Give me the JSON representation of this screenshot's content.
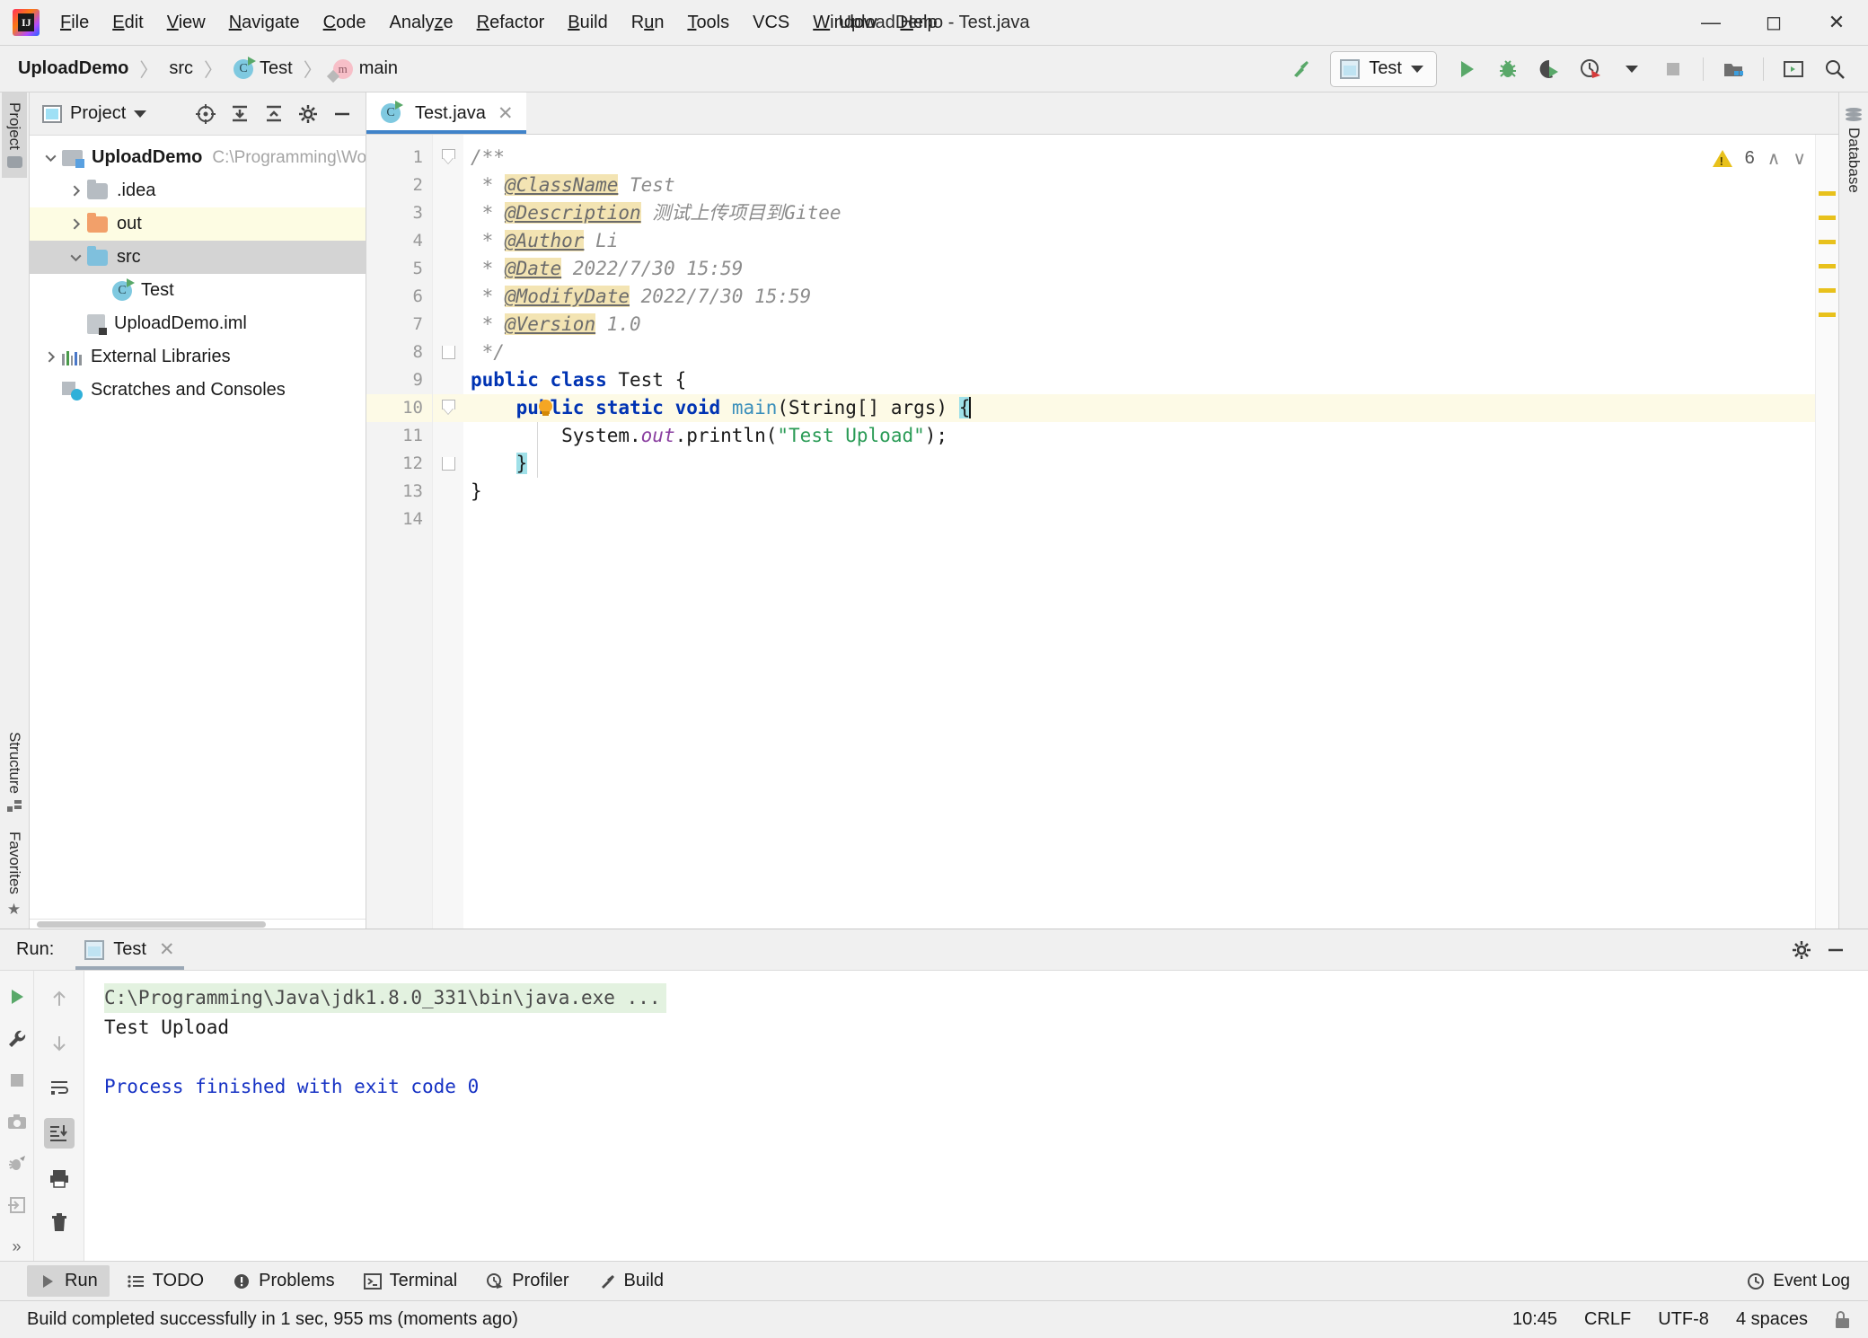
{
  "window": {
    "title": "UploadDemo - Test.java",
    "minimize_label": "─",
    "maximize_label": "☐",
    "close_label": "✕",
    "logo_letter": "IJ"
  },
  "menubar": {
    "items": [
      {
        "label": "File",
        "mnemonic": "F"
      },
      {
        "label": "Edit",
        "mnemonic": "E"
      },
      {
        "label": "View",
        "mnemonic": "V"
      },
      {
        "label": "Navigate",
        "mnemonic": "N"
      },
      {
        "label": "Code",
        "mnemonic": "C"
      },
      {
        "label": "Analyze",
        "mnemonic": "z"
      },
      {
        "label": "Refactor",
        "mnemonic": "R"
      },
      {
        "label": "Build",
        "mnemonic": "B"
      },
      {
        "label": "Run",
        "mnemonic": "u"
      },
      {
        "label": "Tools",
        "mnemonic": "T"
      },
      {
        "label": "VCS",
        "mnemonic": ""
      },
      {
        "label": "Window",
        "mnemonic": "W"
      },
      {
        "label": "Help",
        "mnemonic": "H"
      }
    ]
  },
  "navbar": {
    "breadcrumbs": [
      {
        "label": "UploadDemo",
        "icon": "none",
        "bold": true
      },
      {
        "label": "src",
        "icon": "none",
        "bold": false
      },
      {
        "label": "Test",
        "icon": "class-icon",
        "bold": false
      },
      {
        "label": "main",
        "icon": "method-icon",
        "bold": false
      }
    ],
    "separator": "〉",
    "run_config": {
      "name": "Test",
      "icon": "run-configuration-icon"
    },
    "buttons": [
      {
        "name": "build-hammer-icon",
        "title": "Build Project"
      },
      {
        "name": "run-icon",
        "title": "Run"
      },
      {
        "name": "debug-icon",
        "title": "Debug"
      },
      {
        "name": "run-with-coverage-icon",
        "title": "Run with Coverage"
      },
      {
        "name": "profile-icon",
        "title": "Profile"
      },
      {
        "name": "stop-icon",
        "title": "Stop"
      },
      {
        "name": "update-project-icon",
        "title": "Update Project"
      },
      {
        "name": "search-everywhere-icon",
        "title": "Search Everywhere"
      }
    ]
  },
  "left_rail": {
    "top": [
      {
        "label": "Project",
        "active": true,
        "icon": "project-folder-icon"
      }
    ],
    "bottom": [
      {
        "label": "Structure",
        "active": false,
        "icon": "structure-icon"
      },
      {
        "label": "Favorites",
        "active": false,
        "icon": "star-icon"
      }
    ]
  },
  "right_rail": {
    "items": [
      {
        "label": "Database",
        "icon": "database-icon"
      }
    ]
  },
  "project_panel": {
    "title": "Project",
    "actions": [
      {
        "name": "select-opened-file-icon",
        "title": "Select Opened File"
      },
      {
        "name": "expand-all-icon",
        "title": "Expand All"
      },
      {
        "name": "collapse-all-icon",
        "title": "Collapse All"
      },
      {
        "name": "settings-gear-icon",
        "title": "Options"
      },
      {
        "name": "hide-panel-icon",
        "title": "Hide"
      }
    ],
    "tree": [
      {
        "label": "UploadDemo",
        "suffix": "C:\\Programming\\Workspac",
        "indent": 0,
        "chevron": "down",
        "icon": "module-folder-icon",
        "bold": true,
        "state": "normal"
      },
      {
        "label": ".idea",
        "suffix": "",
        "indent": 1,
        "chevron": "right",
        "icon": "folder-gray-icon",
        "bold": false,
        "state": "normal"
      },
      {
        "label": "out",
        "suffix": "",
        "indent": 1,
        "chevron": "right",
        "icon": "folder-orange-icon",
        "bold": false,
        "state": "excluded"
      },
      {
        "label": "src",
        "suffix": "",
        "indent": 1,
        "chevron": "down",
        "icon": "folder-blue-icon",
        "bold": false,
        "state": "selected"
      },
      {
        "label": "Test",
        "suffix": "",
        "indent": 2,
        "chevron": "none",
        "icon": "java-class-icon",
        "bold": false,
        "state": "normal"
      },
      {
        "label": "UploadDemo.iml",
        "suffix": "",
        "indent": 1,
        "chevron": "none",
        "icon": "iml-file-icon",
        "bold": false,
        "state": "normal"
      },
      {
        "label": "External Libraries",
        "suffix": "",
        "indent": 0,
        "chevron": "right",
        "icon": "libraries-icon",
        "bold": false,
        "state": "normal"
      },
      {
        "label": "Scratches and Consoles",
        "suffix": "",
        "indent": 0,
        "chevron": "none",
        "icon": "scratches-icon",
        "bold": false,
        "state": "normal"
      }
    ]
  },
  "editor": {
    "tab": {
      "label": "Test.java",
      "icon": "java-class-icon",
      "close": "✕"
    },
    "warnings": {
      "count": "6",
      "icon": "warning-triangle-icon",
      "up": "∧",
      "down": "∨"
    },
    "lines": [
      {
        "n": "1",
        "fold": "start",
        "gutter_run": false,
        "current": false,
        "tokens": [
          {
            "t": "/**",
            "c": "cmt"
          }
        ]
      },
      {
        "n": "2",
        "fold": "none",
        "gutter_run": false,
        "current": false,
        "tokens": [
          {
            "t": " * ",
            "c": "cmt"
          },
          {
            "t": "@ClassName",
            "c": "tag"
          },
          {
            "t": " Test",
            "c": "cmt"
          }
        ]
      },
      {
        "n": "3",
        "fold": "none",
        "gutter_run": false,
        "current": false,
        "tokens": [
          {
            "t": " * ",
            "c": "cmt"
          },
          {
            "t": "@Description",
            "c": "tag"
          },
          {
            "t": " 测试上传项目到Gitee",
            "c": "cmt"
          }
        ]
      },
      {
        "n": "4",
        "fold": "none",
        "gutter_run": false,
        "current": false,
        "tokens": [
          {
            "t": " * ",
            "c": "cmt"
          },
          {
            "t": "@Author",
            "c": "tag"
          },
          {
            "t": " Li",
            "c": "cmt"
          }
        ]
      },
      {
        "n": "5",
        "fold": "none",
        "gutter_run": false,
        "current": false,
        "tokens": [
          {
            "t": " * ",
            "c": "cmt"
          },
          {
            "t": "@Date",
            "c": "tag"
          },
          {
            "t": " 2022/7/30 15:59",
            "c": "cmt"
          }
        ]
      },
      {
        "n": "6",
        "fold": "none",
        "gutter_run": false,
        "current": false,
        "tokens": [
          {
            "t": " * ",
            "c": "cmt"
          },
          {
            "t": "@ModifyDate",
            "c": "tag"
          },
          {
            "t": " 2022/7/30 15:59",
            "c": "cmt"
          }
        ]
      },
      {
        "n": "7",
        "fold": "none",
        "gutter_run": false,
        "current": false,
        "tokens": [
          {
            "t": " * ",
            "c": "cmt"
          },
          {
            "t": "@Version",
            "c": "tag"
          },
          {
            "t": " 1.0",
            "c": "cmt"
          }
        ]
      },
      {
        "n": "8",
        "fold": "end",
        "gutter_run": false,
        "current": false,
        "tokens": [
          {
            "t": " */",
            "c": "cmt"
          }
        ]
      },
      {
        "n": "9",
        "fold": "none",
        "gutter_run": true,
        "current": false,
        "tokens": [
          {
            "t": "public class",
            "c": "kw"
          },
          {
            "t": " Test {",
            "c": "plain"
          }
        ]
      },
      {
        "n": "10",
        "fold": "start",
        "gutter_run": true,
        "current": true,
        "tokens": [
          {
            "t": "    ",
            "c": "plain"
          },
          {
            "t": "public static void",
            "c": "kw"
          },
          {
            "t": " ",
            "c": "plain"
          },
          {
            "t": "main",
            "c": "mth"
          },
          {
            "t": "(String[] args) ",
            "c": "plain"
          },
          {
            "t": "{",
            "c": "brace"
          }
        ]
      },
      {
        "n": "11",
        "fold": "none",
        "gutter_run": false,
        "current": false,
        "tokens": [
          {
            "t": "        System.",
            "c": "plain"
          },
          {
            "t": "out",
            "c": "stat"
          },
          {
            "t": ".println(",
            "c": "plain"
          },
          {
            "t": "\"Test Upload\"",
            "c": "str"
          },
          {
            "t": ");",
            "c": "plain"
          }
        ]
      },
      {
        "n": "12",
        "fold": "end",
        "gutter_run": false,
        "current": false,
        "tokens": [
          {
            "t": "    ",
            "c": "plain"
          },
          {
            "t": "}",
            "c": "brace"
          }
        ]
      },
      {
        "n": "13",
        "fold": "none",
        "gutter_run": false,
        "current": false,
        "tokens": [
          {
            "t": "}",
            "c": "plain"
          }
        ]
      },
      {
        "n": "14",
        "fold": "none",
        "gutter_run": false,
        "current": false,
        "tokens": []
      }
    ],
    "marker_count": 6
  },
  "run_panel": {
    "label": "Run:",
    "tab": {
      "label": "Test",
      "icon": "run-configuration-icon",
      "close": "✕"
    },
    "head_actions": [
      {
        "name": "settings-gear-icon",
        "title": "Settings"
      },
      {
        "name": "hide-panel-icon",
        "title": "Hide"
      }
    ],
    "toolbar_left": [
      {
        "name": "rerun-icon",
        "title": "Rerun"
      },
      {
        "name": "wrench-icon",
        "title": "Edit Configuration"
      },
      {
        "name": "stop-icon",
        "title": "Stop"
      },
      {
        "name": "screenshot-icon",
        "title": "Screenshot"
      },
      {
        "name": "dump-threads-icon",
        "title": "Dump Threads"
      },
      {
        "name": "export-icon",
        "title": "Export"
      },
      {
        "name": "more-icon",
        "title": "More"
      }
    ],
    "toolbar_right": [
      {
        "name": "up-arrow-icon",
        "title": "Previous"
      },
      {
        "name": "down-arrow-icon",
        "title": "Next"
      },
      {
        "name": "soft-wrap-icon",
        "title": "Soft-Wrap"
      },
      {
        "name": "scroll-to-end-icon",
        "title": "Scroll to End",
        "active": true
      },
      {
        "name": "print-icon",
        "title": "Print"
      },
      {
        "name": "clear-all-icon",
        "title": "Clear All"
      }
    ],
    "console": [
      {
        "text": "C:\\Programming\\Java\\jdk1.8.0_331\\bin\\java.exe ...",
        "style": "cmd"
      },
      {
        "text": "Test Upload",
        "style": "out"
      },
      {
        "text": "",
        "style": "out"
      },
      {
        "text": "Process finished with exit code 0",
        "style": "fin"
      }
    ]
  },
  "tool_window_bar": {
    "items": [
      {
        "label": "Run",
        "icon": "run-icon",
        "active": true
      },
      {
        "label": "TODO",
        "icon": "todo-list-icon",
        "active": false
      },
      {
        "label": "Problems",
        "icon": "problems-icon",
        "active": false
      },
      {
        "label": "Terminal",
        "icon": "terminal-icon",
        "active": false
      },
      {
        "label": "Profiler",
        "icon": "profiler-icon",
        "active": false
      },
      {
        "label": "Build",
        "icon": "build-hammer-icon",
        "active": false
      }
    ],
    "right": {
      "label": "Event Log",
      "icon": "event-log-icon"
    }
  },
  "status_bar": {
    "message": "Build completed successfully in 1 sec, 955 ms (moments ago)",
    "time": "10:45",
    "line_separator": "CRLF",
    "encoding": "UTF-8",
    "indent": "4 spaces",
    "lock_icon": "unlocked-icon"
  },
  "colors": {
    "accent_blue": "#4083c9",
    "warning_yellow": "#e8c11c",
    "green_run": "#59a869",
    "keyword_blue": "#0033b3",
    "string_green": "#2a9b56",
    "excluded_bg": "#fdfce3",
    "current_line_bg": "#fdfae6"
  }
}
